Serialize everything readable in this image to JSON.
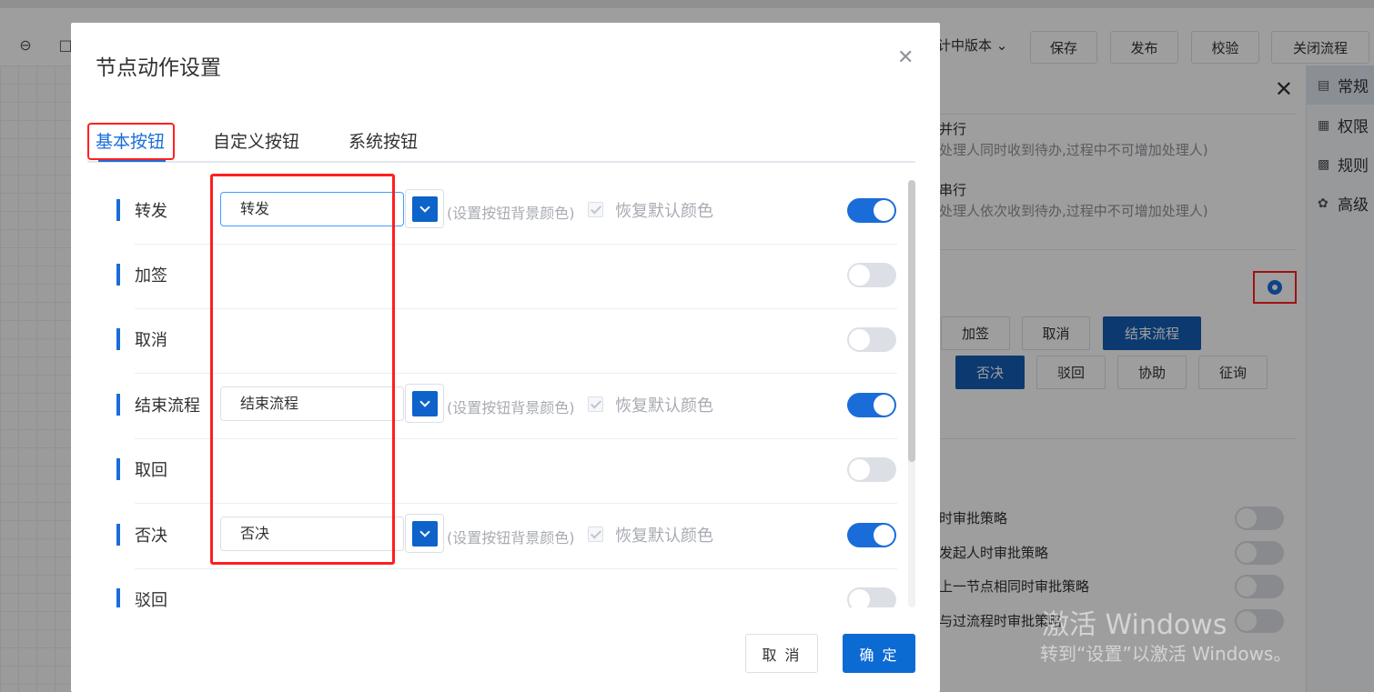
{
  "toolbar": {
    "version_label": "计中版本",
    "buttons": [
      "保存",
      "发布",
      "校验",
      "关闭流程"
    ]
  },
  "right_panel": {
    "mode_parallel_title": "并行",
    "mode_parallel_desc": "处理人同时收到待办,过程中不可增加处理人)",
    "mode_serial_title": "串行",
    "mode_serial_desc": "处理人依次收到待办,过程中不可增加处理人)",
    "action_buttons": [
      "加签",
      "取消",
      "结束流程",
      "否决",
      "驳回",
      "协助",
      "征询"
    ],
    "strategies": [
      "时审批策略",
      "发起人时审批策略",
      "上一节点相同时审批策略",
      "与过流程时审批策略"
    ]
  },
  "side_tabs": [
    "常规",
    "权限",
    "规则",
    "高级"
  ],
  "modal": {
    "title": "节点动作设置",
    "tabs": [
      "基本按钮",
      "自定义按钮",
      "系统按钮"
    ],
    "hint": "(设置按钮背景颜色)",
    "reset_label": "恢复默认颜色",
    "rows": [
      {
        "label": "转发",
        "value": "转发",
        "enabled": true
      },
      {
        "label": "加签",
        "value": "",
        "enabled": false
      },
      {
        "label": "取消",
        "value": "",
        "enabled": false
      },
      {
        "label": "结束流程",
        "value": "结束流程",
        "enabled": true
      },
      {
        "label": "取回",
        "value": "",
        "enabled": false
      },
      {
        "label": "否决",
        "value": "否决",
        "enabled": true
      },
      {
        "label": "驳回",
        "value": "",
        "enabled": false
      }
    ],
    "cancel_label": "取 消",
    "ok_label": "确 定",
    "accent_color": "#1a6dd8"
  },
  "watermark": {
    "line1": "激活 Windows",
    "line2": "转到“设置”以激活 Windows。"
  }
}
